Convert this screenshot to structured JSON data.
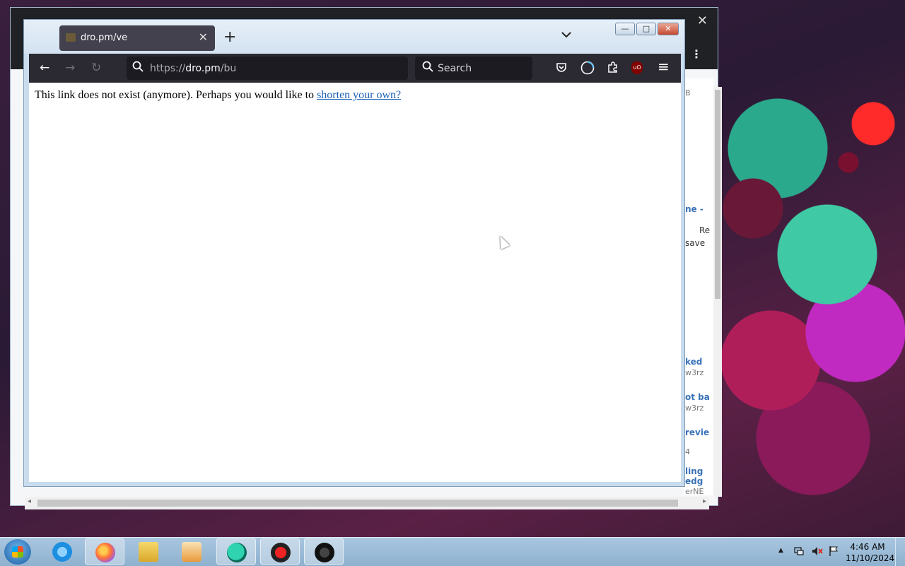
{
  "background_window": {
    "side_snippets": [
      "B",
      "ne -",
      "Re",
      "save",
      "ked",
      "w3rz",
      "ot ba",
      "w3rz",
      "revie",
      "4",
      "ling",
      "edg",
      "erNE"
    ]
  },
  "firefox": {
    "tab": {
      "title": "dro.pm/ve",
      "close_glyph": "✕"
    },
    "new_tab_glyph": "+",
    "tab_list_glyph": "⌄",
    "window_controls": {
      "minimize": "—",
      "maximize": "□",
      "close": "✕"
    },
    "toolbar": {
      "back_glyph": "←",
      "forward_glyph": "→",
      "reload_glyph": "↻",
      "url_scheme": "https://",
      "url_host": "dro.pm",
      "url_path": "/bu",
      "search_placeholder": "Search",
      "ublock_label": "uO",
      "menu_glyph": "≡"
    },
    "page": {
      "message": "This link does not exist (anymore). Perhaps you would like to ",
      "link_text": "shorten your own?"
    }
  },
  "taskbar": {
    "clock_time": "4:46 AM",
    "clock_date": "11/10/2024",
    "tray_expand_glyph": "▲"
  },
  "colors": {
    "firefox_toolbar": "#2b2a33",
    "url_field": "#1c1b22",
    "link": "#1a5fb4",
    "taskbar": "#a9c6df"
  }
}
